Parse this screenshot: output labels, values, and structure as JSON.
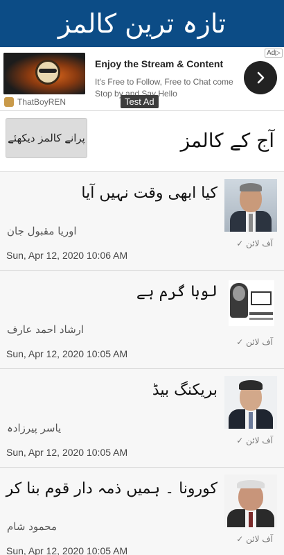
{
  "header": {
    "title": "تازہ ترین کالمز"
  },
  "ad": {
    "headline": "Enjoy the Stream & Content",
    "body": "It's Free to Follow, Free to Chat come Stop by and Say Hello",
    "channel": "ThatBoyREN",
    "label": "Test Ad",
    "choice_label": "Ad",
    "arrow_icon": "chevron-right-icon"
  },
  "section": {
    "title": "آج کے کالمز",
    "old_button_label": "پرانے کالمز دیکھئے"
  },
  "columns": [
    {
      "title": "کیا ابھی وقت نہیں آیا",
      "author": "اوریا مقبول جان",
      "status": "آف لائن ✓",
      "date": "Sun, Apr 12, 2020 10:06 AM"
    },
    {
      "title": "لوہا گرم ہے",
      "author": "ارشاد احمد عارف",
      "status": "آف لائن ✓",
      "date": "Sun, Apr 12, 2020 10:05 AM"
    },
    {
      "title": "بریکنگ بیڈ",
      "author": "یاسر پیرزادہ",
      "status": "آف لائن ✓",
      "date": "Sun, Apr 12, 2020 10:05 AM"
    },
    {
      "title": "کورونا ۔ ہمیں ذمہ دار قوم بنا کر جائے گا",
      "author": "محمود شام",
      "status": "آف لائن ✓",
      "date": "Sun, Apr 12, 2020 10:05 AM"
    }
  ]
}
